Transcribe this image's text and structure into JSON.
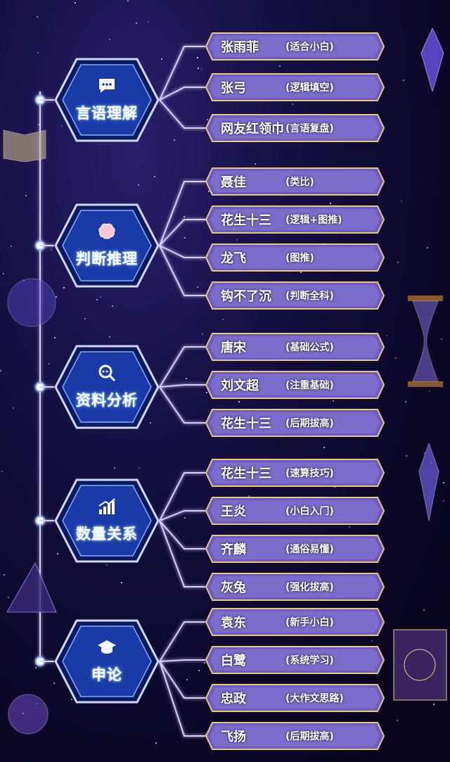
{
  "categories": [
    {
      "label": "言语理解",
      "icon": "chat-bubble-icon",
      "teachers": [
        {
          "name": "张雨菲",
          "note": "(适合小白)"
        },
        {
          "name": "张弓",
          "note": "(逻辑填空)"
        },
        {
          "name": "网友红领巾",
          "note": "(言语复盘)"
        }
      ]
    },
    {
      "label": "判断推理",
      "icon": "brain-icon",
      "teachers": [
        {
          "name": "聂佳",
          "note": "(类比)"
        },
        {
          "name": "花生十三",
          "note": "(逻辑+图推)"
        },
        {
          "name": "龙飞",
          "note": "(图推)"
        },
        {
          "name": "钩不了沉",
          "note": "(判断全科)"
        }
      ]
    },
    {
      "label": "资料分析",
      "icon": "magnifier-icon",
      "teachers": [
        {
          "name": "唐宋",
          "note": "(基础公式)"
        },
        {
          "name": "刘文超",
          "note": "(注重基础)"
        },
        {
          "name": "花生十三",
          "note": "(后期拔高)"
        }
      ]
    },
    {
      "label": "数量关系",
      "icon": "rising-bar-chart-icon",
      "teachers": [
        {
          "name": "花生十三",
          "note": "(速算技巧)"
        },
        {
          "name": "王炎",
          "note": "(小白入门)"
        },
        {
          "name": "齐麟",
          "note": "(通俗易懂)"
        },
        {
          "name": "灰兔",
          "note": "(强化拔高)"
        }
      ]
    },
    {
      "label": "申论",
      "icon": "graduation-cap-icon",
      "teachers": [
        {
          "name": "袁东",
          "note": "(新手小白)"
        },
        {
          "name": "白鹭",
          "note": "(系统学习)"
        },
        {
          "name": "忠政",
          "note": "(大作文思路)"
        },
        {
          "name": "飞扬",
          "note": "(后期拔高)"
        }
      ]
    }
  ],
  "colors": {
    "glow": "#bfa8ff",
    "hex_fill": "#1a3aa8",
    "tag_fill": "#6b5bbf",
    "gold": "#e8c77a"
  }
}
